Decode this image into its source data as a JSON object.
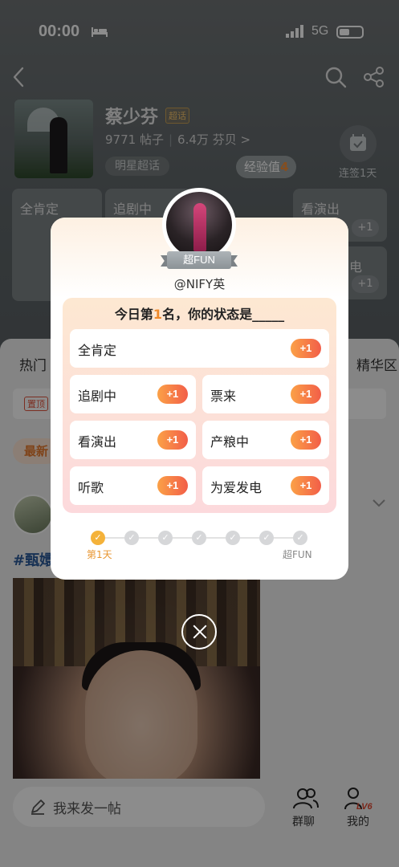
{
  "status_bar": {
    "time": "00:00",
    "network": "5G"
  },
  "header": {
    "topic_name": "蔡少芬",
    "super_badge": "超话",
    "posts_count": "9771",
    "posts_label": "帖子",
    "fans_count": "6.4万",
    "fans_label": "芬贝 >",
    "category_tag": "明星超话",
    "exp_label": "经验值",
    "exp_value": "4",
    "checkin_label": "连签1天"
  },
  "underlay_grid": [
    {
      "label": "全肯定"
    },
    {
      "label": "追剧中"
    },
    {
      "label": "看演出"
    },
    {
      "label": "电"
    }
  ],
  "tabs": [
    "热门",
    "精华区"
  ],
  "pinned_badge": "置顶",
  "latest_filter": "最新",
  "post": {
    "hashtag": "#甄嬛"
  },
  "bottom_bar": {
    "compose_placeholder": "我来发一帖",
    "group_chat": "群聊",
    "mine": "我的",
    "level_badge": "LV6"
  },
  "modal": {
    "badge": "超FUN",
    "username": "@NIFY英",
    "question_prefix": "今日第",
    "rank": "1",
    "question_suffix": "名，你的状态是_____",
    "options": [
      {
        "label": "全肯定",
        "reward": "+1"
      },
      {
        "label": "追剧中",
        "reward": "+1"
      },
      {
        "label": "票来",
        "reward": "+1"
      },
      {
        "label": "看演出",
        "reward": "+1"
      },
      {
        "label": "产粮中",
        "reward": "+1"
      },
      {
        "label": "听歌",
        "reward": "+1"
      },
      {
        "label": "为爱发电",
        "reward": "+1"
      }
    ],
    "progress": {
      "current_step": 1,
      "total_steps": 7,
      "start_label": "第1天",
      "end_label": "超FUN"
    }
  },
  "colors": {
    "accent_orange": "#f28e3a",
    "plus_gradient_start": "#fba147",
    "plus_gradient_end": "#f25e48"
  }
}
